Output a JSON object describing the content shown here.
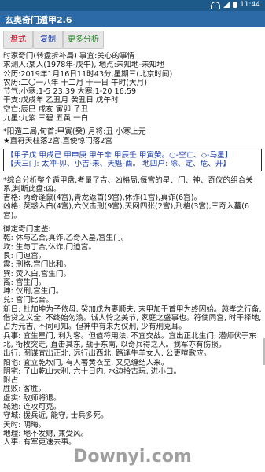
{
  "status_bar": {
    "time": "11:44"
  },
  "app_title": "玄奥奇门遁甲2.6",
  "toolbar": {
    "pan_label": "盘式",
    "copy_label": "复制",
    "more_label": "更多分析"
  },
  "chart_header": {
    "lines": [
      "时家奇门(转盘拆补局) 事宜:关心的事情",
      "求测人:某人(1978年-戊午), 地点:未知地-未知地",
      "公历:2019年1月16日11时43分,星期三(北京时间)",
      "农历:二〇一八年 十二月 十一日 午时(大月)",
      "节气:小寒:1-5 23:39 大寒:1-20 16:59",
      "干支:戊戌年 乙丑月 癸丑日 戊午时",
      "空亡:辰巳    戌亥    寅卯    子丑",
      "九星:九紫    三碧    五黄    一白"
    ],
    "ju_line": "*阳遁二局,旬首:甲寅(癸) 月将:丑 小寒上元",
    "zhi_line": "★直符天柱落2宫,直使惊门落2宫"
  },
  "xun_box": {
    "line1": "【甲子戊 甲戌己 甲申庚 甲午辛 甲辰壬 甲寅癸。○-空亡、◇-马星】",
    "line2": "【天三门: 太冲-卯、小吉-未、天魁-酉。  地四户: 除、定、危、开】"
  },
  "analysis": {
    "intro": "*综合分析整个遁甲盘,考量了吉、凶格局,每宫的星、门、神、奇仪的组合关系,判断此盘:凶。",
    "ji_ge": "吉格: 丙奇逢鼠(4宫),青龙返首(9宫),休诈(1宫),真诈(6宫)。",
    "xiong_ge": "凶格: 荧惑入白(4宫),六仪击刑(9宫),天网四张(2宫),刑格(3宫),三奇入墓(6宫)。"
  },
  "gong": {
    "title": "御定奇门宝鉴:",
    "lines": [
      "乾: 休与乙合,真诈,乙奇入墓,宫生门。",
      "坎: 生与丁合,休诈,门迫宫。",
      "艮: 门迫宫。",
      "震: 刑格,宫门比和。",
      "巽: 荧入白,宫生门。",
      "离: 宫生门。",
      "坤: 仪刑,宫生门。",
      "兑: 宫门比合。"
    ]
  },
  "xinshi": {
    "text": "新日: 杜加坤为子依母, 癸加戊为妻顺夫, 末甲加于首甲为终因始。慈孝之行备, 借贷之义全, 不终始勿渝。诚人怜之美节, 家庭之盛事也。符使同宫, 时干择地, 占为元吉, 不同可知。但神中有未为仪刑, 少有刑克耳。"
  },
  "bing_fa": {
    "text": "兵事: 宜生星门, 利为客。但值符用法, 不宜交战。宜出正北生门, 潜师伏于东北, 衔枚突走, 直击其东, 战于东南, 以奇兵得之人。我军亦有伤损。"
  },
  "tail_lines": [
    "出行: 图谋宜出正北, 远行出西北, 路逢牛羊女人, 公吏喧歌应。",
    "阳宅: 宜立乾坎门, 有人著黄衣至, 又见缠结人来。",
    "阴宅: 子山乾山大利, 六十日内, 水边拾古玩, 进小口。",
    "附占",
    "胜败: 客胜。",
    "虚实: 敌师将退。",
    "城池: 连攻可克。",
    "守城: 援兵近, 能守, 士兵多死。",
    "天时: 阴晦。",
    "地理: 地不发财, 兼受风。",
    "人事: 有军更速去事。"
  ],
  "watermark": "Downyi.com"
}
